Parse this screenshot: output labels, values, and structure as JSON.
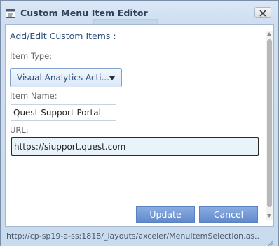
{
  "window": {
    "title": "Custom Menu Item Editor",
    "close_icon": "close-icon"
  },
  "form": {
    "heading": "Add/Edit Custom Items :",
    "item_type_label": "Item Type:",
    "item_type_value": "Visual Analytics Acti...",
    "item_name_label": "Item Name:",
    "item_name_value": "Quest Support Portal",
    "url_label": "URL:",
    "url_value": "https://siupport.quest.com"
  },
  "buttons": {
    "update_label": "Update",
    "cancel_label": "Cancel"
  },
  "statusbar": {
    "url": "http://cp-sp19-a-ss:1818/_layouts/axceler/MenuItemSelection.as..."
  },
  "colors": {
    "accent": "#6f94d4",
    "heading_text": "#2d4f7c",
    "window_frame": "#dbe8f6"
  }
}
